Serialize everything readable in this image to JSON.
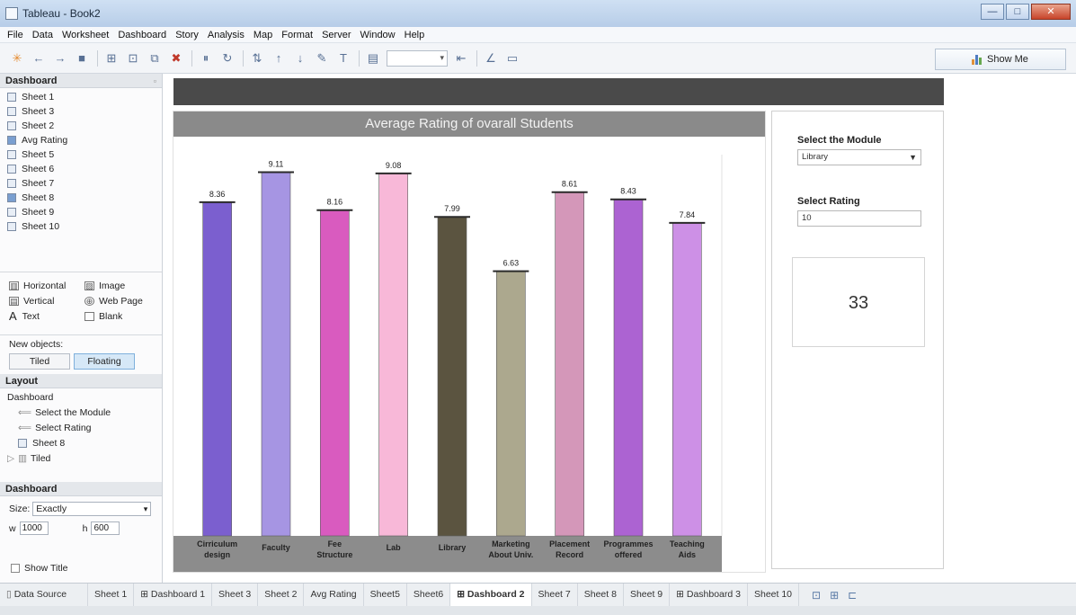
{
  "window": {
    "title": "Tableau - Book2",
    "min": "—",
    "max": "□",
    "close": "✕"
  },
  "menu": [
    "File",
    "Data",
    "Worksheet",
    "Dashboard",
    "Story",
    "Analysis",
    "Map",
    "Format",
    "Server",
    "Window",
    "Help"
  ],
  "toolbar": {
    "show_me": "Show Me"
  },
  "left_panel": {
    "dashboard_header": "Dashboard",
    "sheets": [
      "Sheet 1",
      "Sheet 3",
      "Sheet 2",
      "Avg Rating",
      "Sheet 5",
      "Sheet 6",
      "Sheet 7",
      "Sheet 8",
      "Sheet 9",
      "Sheet 10"
    ],
    "objects": {
      "horizontal": "Horizontal",
      "image": "Image",
      "vertical": "Vertical",
      "web_page": "Web Page",
      "text": "Text",
      "blank": "Blank"
    },
    "new_objects_label": "New objects:",
    "tiled": "Tiled",
    "floating": "Floating",
    "layout_header": "Layout",
    "layout_tree": {
      "root": "Dashboard",
      "items": [
        "Select the Module",
        "Select Rating",
        "Sheet 8",
        "Tiled"
      ]
    },
    "size_header": "Dashboard",
    "size_label": "Size:",
    "size_value": "Exactly",
    "w_label": "w",
    "w_value": "1000",
    "h_label": "h",
    "h_value": "600",
    "show_title": "Show Title"
  },
  "chart_data": {
    "type": "bar",
    "title": "Average Rating of ovarall Students",
    "categories": [
      "Cirriculum design",
      "Faculty",
      "Fee Structure",
      "Lab",
      "Library",
      "Marketing About Univ.",
      "Placement Record",
      "Programmes offered",
      "Teaching Aids"
    ],
    "values": [
      8.36,
      9.11,
      8.16,
      9.08,
      7.99,
      6.63,
      8.61,
      8.43,
      7.84
    ],
    "labels": [
      "8.36",
      "9.11",
      "8.16",
      "9.08",
      "7.99",
      "6.63",
      "8.61",
      "8.43",
      "7.84"
    ],
    "colors": [
      "#7b5fcf",
      "#a695e3",
      "#d95bbf",
      "#f8b8d8",
      "#5b5440",
      "#aca88e",
      "#d497b9",
      "#ac63d2",
      "#cd90e6"
    ],
    "ylim": [
      0,
      10
    ],
    "grid": false,
    "legend": "none"
  },
  "right_panel": {
    "module_label": "Select the Module",
    "module_value": "Library",
    "rating_label": "Select Rating",
    "rating_value": "10",
    "kpi_value": "33"
  },
  "tabs": [
    "Data Source",
    "Sheet 1",
    "Dashboard 1",
    "Sheet 3",
    "Sheet 2",
    "Avg Rating",
    "Sheet5",
    "Sheet6",
    "Dashboard 2",
    "Sheet 7",
    "Sheet 8",
    "Sheet 9",
    "Dashboard 3",
    "Sheet 10"
  ],
  "active_tab": "Dashboard 2"
}
